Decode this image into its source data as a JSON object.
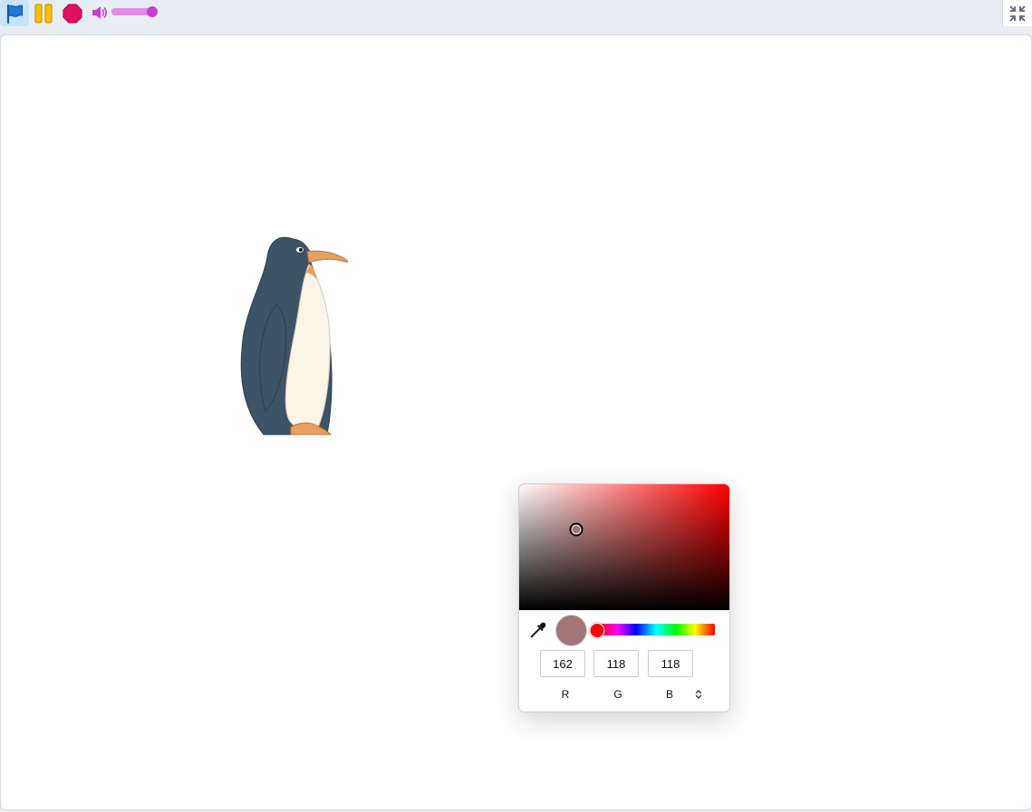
{
  "toolbar": {
    "buttons": [
      {
        "name": "green-flag",
        "icon": "flag-icon",
        "color": "#1e7ad6"
      },
      {
        "name": "pause",
        "icon": "pause-icon",
        "color": "#ffbf00"
      },
      {
        "name": "stop",
        "icon": "stop-icon",
        "color": "#e0115f"
      }
    ],
    "volume": {
      "icon": "speaker-icon",
      "level": 0.9,
      "color": "#c73fd0"
    },
    "fullscreen": {
      "icon": "exit-fullscreen-icon"
    }
  },
  "stage": {
    "sprite": {
      "name": "Penguin"
    }
  },
  "color_picker": {
    "hue": 0,
    "saturation": 0.27,
    "value": 0.64,
    "current_color": "#a27676",
    "eyedropper_icon": "eyedropper-icon",
    "channels": [
      {
        "label": "R",
        "value": "162"
      },
      {
        "label": "G",
        "value": "118"
      },
      {
        "label": "B",
        "value": "118"
      }
    ],
    "mode_toggle_icon": "chevron-up-down-icon"
  }
}
